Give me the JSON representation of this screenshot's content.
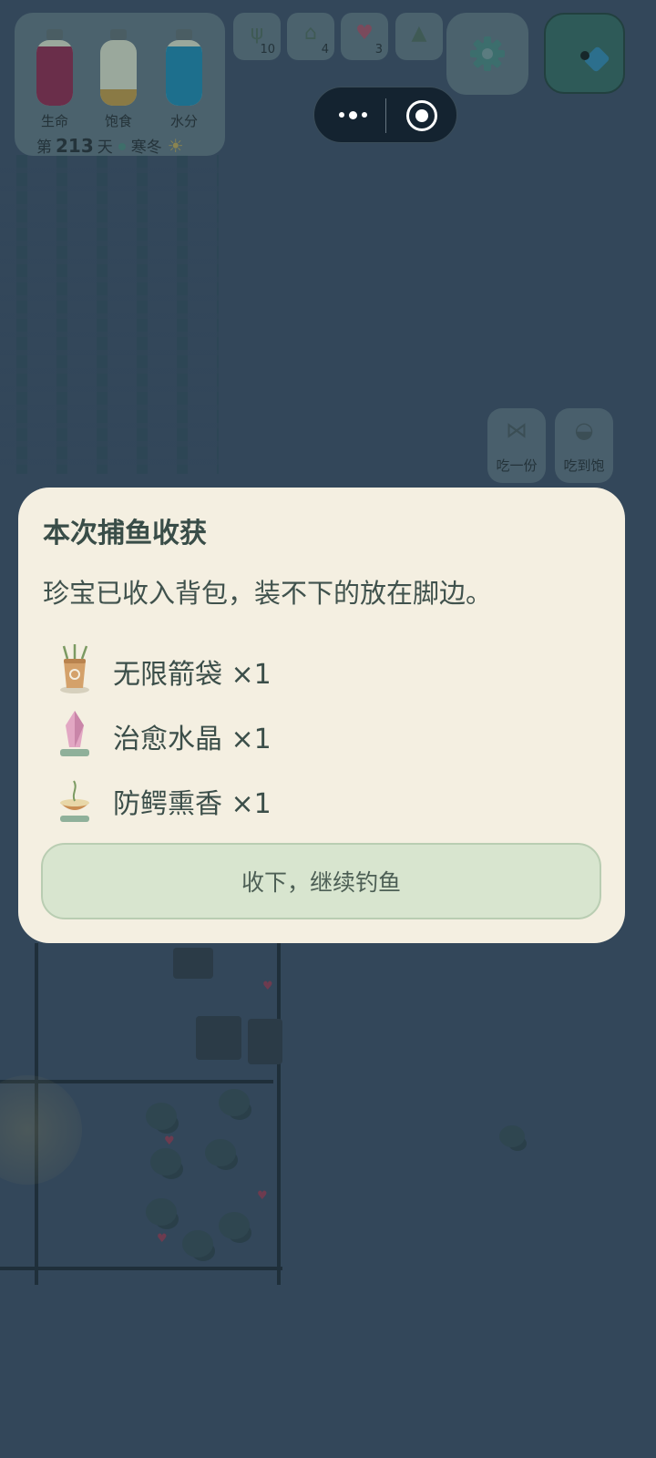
{
  "status": {
    "bottles": [
      {
        "label": "生命",
        "color": "#6a2e4a",
        "level": 0.9
      },
      {
        "label": "饱食",
        "color": "#8a7a45",
        "level": 0.25
      },
      {
        "label": "水分",
        "color": "#1d6f8d",
        "level": 0.9
      }
    ],
    "day_prefix": "第",
    "day_number": "213",
    "day_suffix": "天",
    "season": "寒冬"
  },
  "resources": [
    {
      "icon": "sprout-icon",
      "count": "10"
    },
    {
      "icon": "hut-icon",
      "count": "4"
    },
    {
      "icon": "heart-plus-icon",
      "count": "3"
    },
    {
      "icon": "altar-icon",
      "count": ""
    }
  ],
  "eat_actions": [
    {
      "icon": "fish-icon",
      "label": "吃一份"
    },
    {
      "icon": "pot-icon",
      "label": "吃到饱"
    }
  ],
  "dialog": {
    "title": "本次捕鱼收获",
    "message": "珍宝已收入背包，装不下的放在脚边。",
    "items": [
      {
        "icon": "quiver-icon",
        "name": "无限箭袋",
        "qty": "×1"
      },
      {
        "icon": "crystal-icon",
        "name": "治愈水晶",
        "qty": "×1"
      },
      {
        "icon": "incense-icon",
        "name": "防鳄熏香",
        "qty": "×1"
      }
    ],
    "confirm_label": "收下，继续钓鱼"
  }
}
